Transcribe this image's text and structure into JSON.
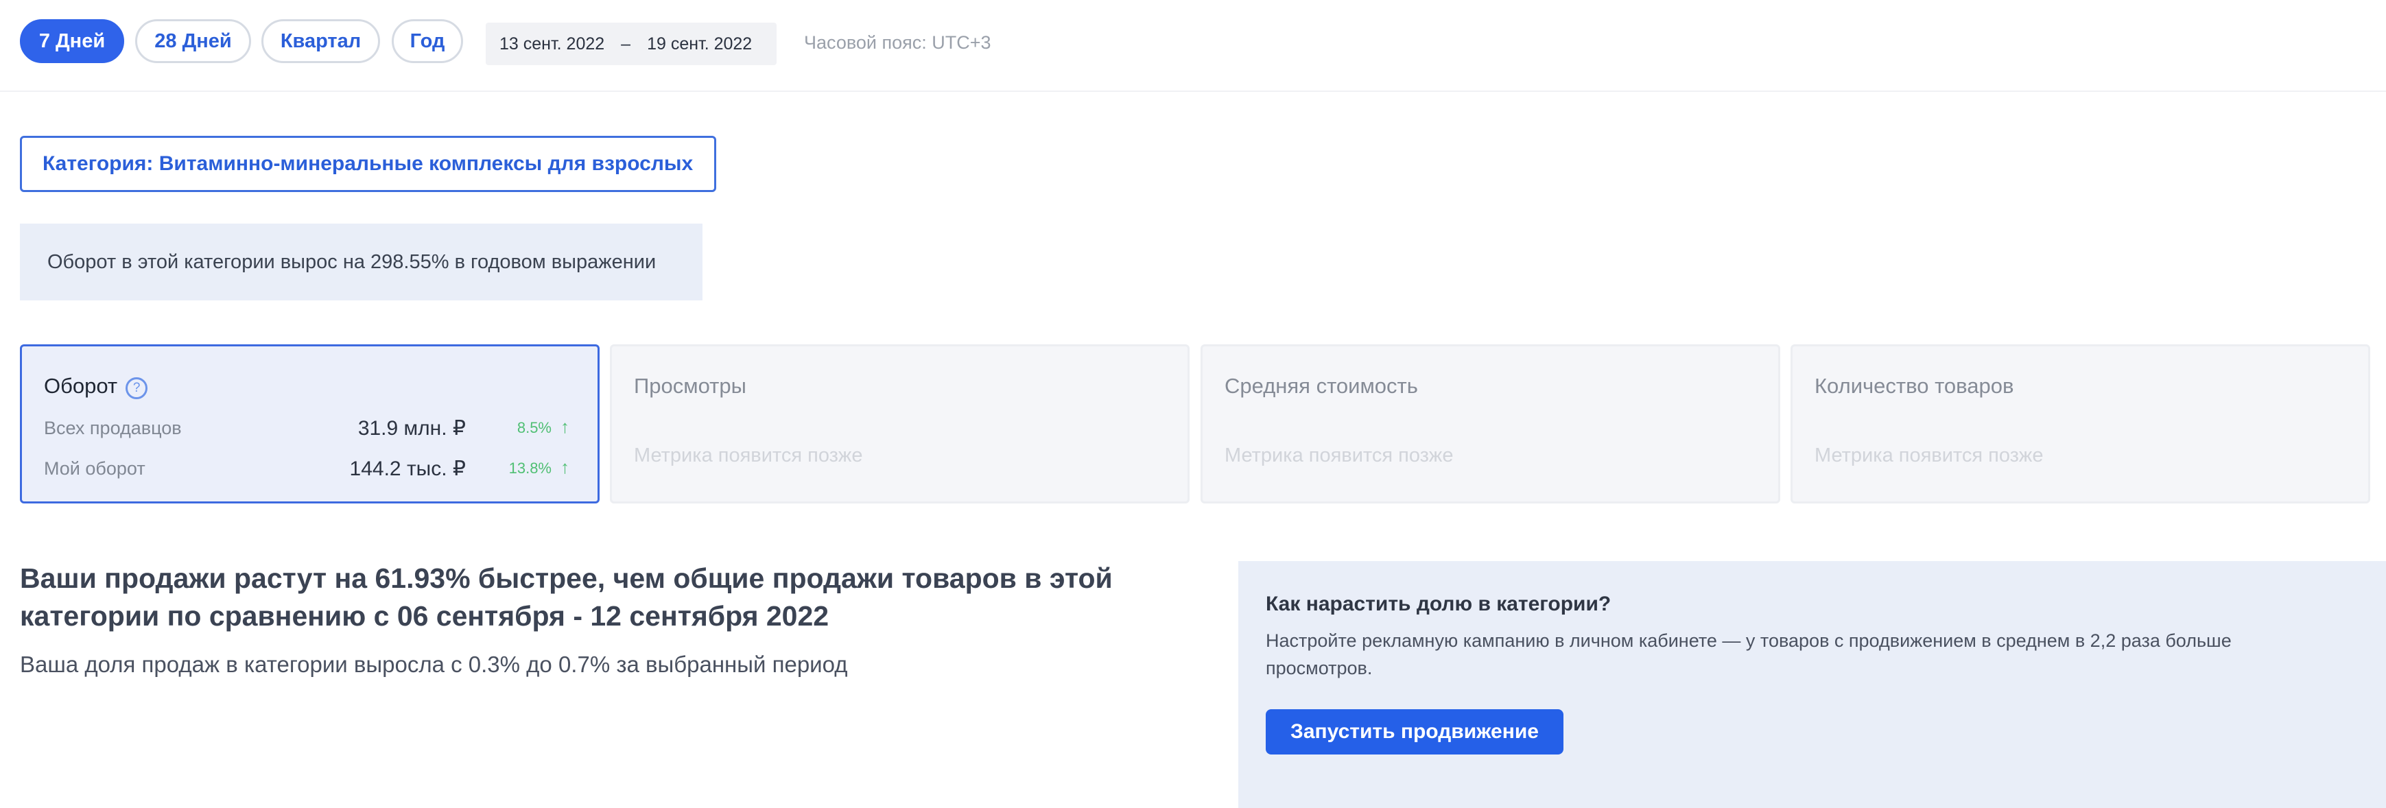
{
  "period_tabs": [
    {
      "label": "7 Дней",
      "active": true
    },
    {
      "label": "28 Дней",
      "active": false
    },
    {
      "label": "Квартал",
      "active": false
    },
    {
      "label": "Год",
      "active": false
    }
  ],
  "date_range": {
    "from": "13 сент. 2022",
    "separator": "–",
    "to": "19 сент. 2022"
  },
  "timezone": "Часовой пояс: UTC+3",
  "category_label": "Категория: Витаминно-минеральные комплексы для взрослых",
  "notice": "Оборот в этой категории вырос на 298.55% в годовом выражении",
  "metrics": {
    "turnover": {
      "title": "Оборот",
      "help_icon": "?",
      "all_sellers": {
        "label": "Всех продавцов",
        "value": "31.9 млн. ₽",
        "change": "8.5%",
        "arrow": "↑"
      },
      "my_turnover": {
        "label": "Мой оборот",
        "value": "144.2 тыс. ₽",
        "change": "13.8%",
        "arrow": "↑"
      }
    },
    "views": {
      "title": "Просмотры",
      "placeholder": "Метрика появится позже"
    },
    "avg_price": {
      "title": "Средняя стоимость",
      "placeholder": "Метрика появится позже"
    },
    "items_count": {
      "title": "Количество товаров",
      "placeholder": "Метрика появится позже"
    }
  },
  "growth": {
    "title": "Ваши продажи растут на 61.93% быстрее, чем общие продажи товаров в этой категории по сравнению с 06 сентября - 12 сентября 2022",
    "subtitle": "Ваша доля продаж в категории выросла с 0.3% до 0.7% за выбранный период"
  },
  "promo": {
    "title": "Как нарастить долю в категории?",
    "text": "Настройте рекламную кампанию в личном кабинете — у товаров с продвижением в среднем в 2,2 раза больше просмотров.",
    "button": "Запустить продвижение"
  },
  "colors": {
    "accent": "#2f63ea",
    "positive": "#4fbf73",
    "info_bg": "#e9eef8"
  }
}
